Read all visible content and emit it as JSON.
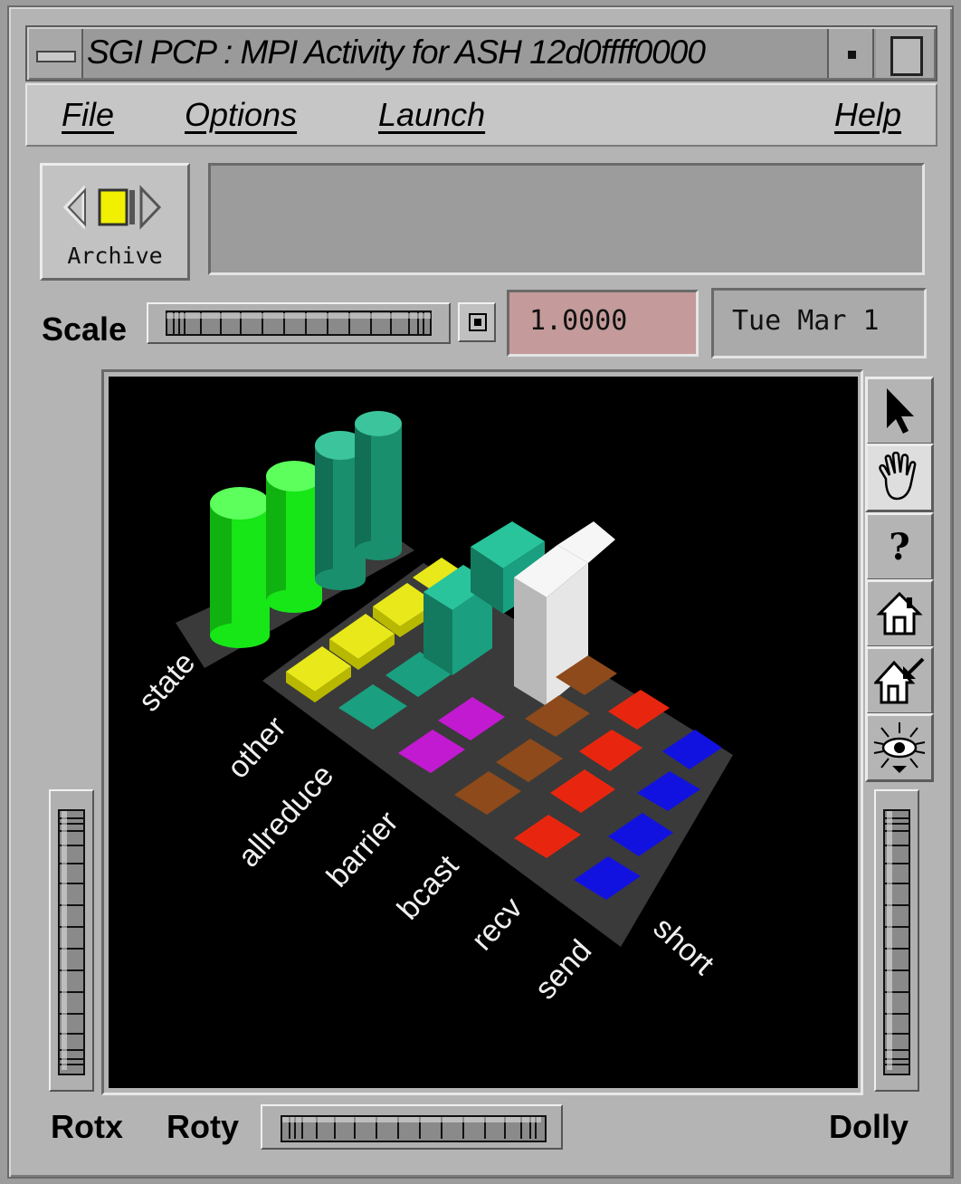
{
  "window": {
    "title": "SGI PCP : MPI Activity for ASH 12d0ffff0000"
  },
  "menubar": {
    "file": "File",
    "options": "Options",
    "launch": "Launch",
    "help": "Help"
  },
  "archive": {
    "label": "Archive"
  },
  "scale": {
    "label": "Scale",
    "value": "1.0000",
    "date": "Tue Mar 1"
  },
  "scene": {
    "state_bars": {
      "row_label": "state",
      "colors": [
        "#17e617",
        "#17e617",
        "#1a8f6e",
        "#1a8f6e"
      ]
    },
    "row_labels": [
      "other",
      "allreduce",
      "barrier",
      "bcast",
      "recv",
      "send",
      "short"
    ],
    "row_colors": {
      "other": "#e8e81a",
      "allreduce": "#1aa080",
      "barrier": "#c21ad0",
      "bcast": "#8e4a1a",
      "recv": "#e8260f",
      "send": "#1212e0",
      "tall_white": "#e6e6e6"
    }
  },
  "tools": {
    "pick": "arrow-cursor-icon",
    "view": "hand-icon",
    "help": "question-mark-icon",
    "home": "home-icon",
    "set_home": "set-home-icon",
    "view_all": "eye-icon"
  },
  "controls": {
    "rotx": "Rotx",
    "roty": "Roty",
    "dolly": "Dolly"
  }
}
